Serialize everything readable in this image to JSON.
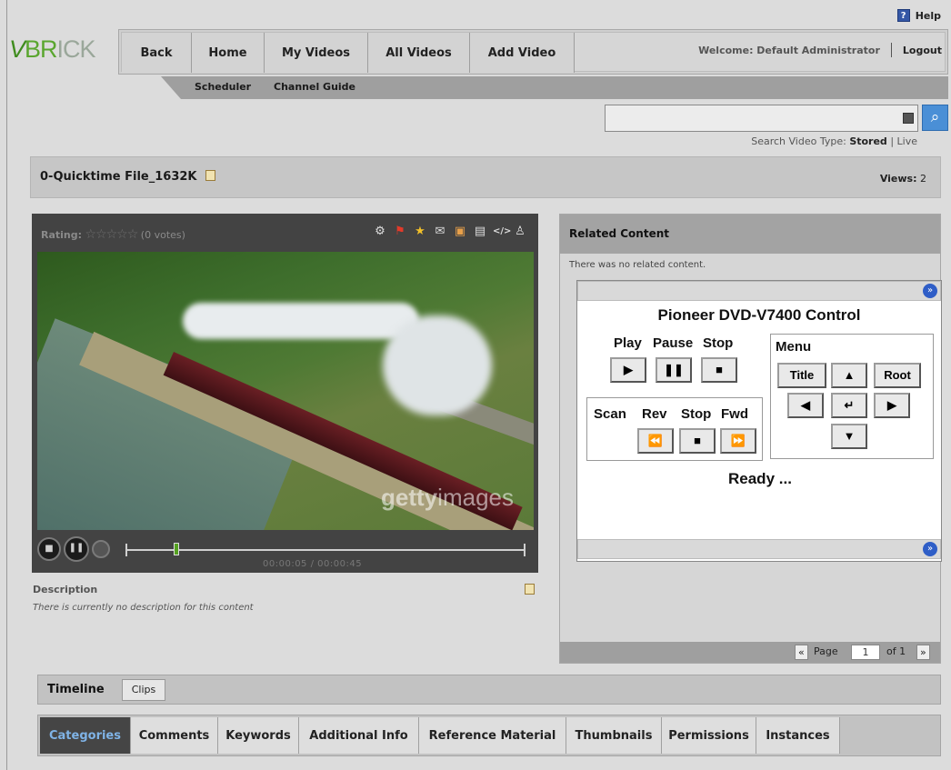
{
  "help": {
    "label": "Help",
    "icon": "?"
  },
  "logo": {
    "v": "V",
    "br": "BR",
    "ick": "ICK"
  },
  "nav": {
    "buttons": [
      "Back",
      "Home",
      "My Videos",
      "All Videos",
      "Add Video"
    ],
    "welcome": "Welcome: Default Administrator",
    "logout": "Logout",
    "sub": [
      "Scheduler",
      "Channel Guide"
    ]
  },
  "search": {
    "value": "",
    "type_label": "Search Video Type:",
    "stored": "Stored",
    "separator": "|",
    "live": "Live"
  },
  "video": {
    "title": "0-Quicktime File_1632K",
    "views_label": "Views:",
    "views": "2",
    "rating_label": "Rating:",
    "stars": "☆☆☆☆☆",
    "votes": "(0 votes)",
    "watermark_a": "getty",
    "watermark_b": "images",
    "time": "00:00:05 / 00:00:45",
    "progress": 0.12
  },
  "description": {
    "heading": "Description",
    "text": "There is currently no description for this content"
  },
  "related": {
    "heading": "Related Content",
    "none": "There was no related content.",
    "widget": {
      "title": "Pioneer DVD-V7400 Control",
      "play": "Play",
      "pause": "Pause",
      "stop": "Stop",
      "menu": "Menu",
      "title_btn": "Title",
      "root_btn": "Root",
      "scan": "Scan",
      "rev": "Rev",
      "stop2": "Stop",
      "fwd": "Fwd",
      "status": "Ready ..."
    },
    "pager": {
      "prev": "«",
      "page_label": "Page",
      "page": "1",
      "of": "of 1",
      "next": "»"
    }
  },
  "timeline": {
    "label": "Timeline",
    "clips": "Clips"
  },
  "tabs": [
    "Categories",
    "Comments",
    "Keywords",
    "Additional Info",
    "Reference Material",
    "Thumbnails",
    "Permissions",
    "Instances"
  ],
  "colors": {
    "brand_green": "#5aa62f",
    "active_tab_bg": "#454545",
    "active_tab_text": "#7fb3e6",
    "search_btn": "#4a8fd6"
  }
}
